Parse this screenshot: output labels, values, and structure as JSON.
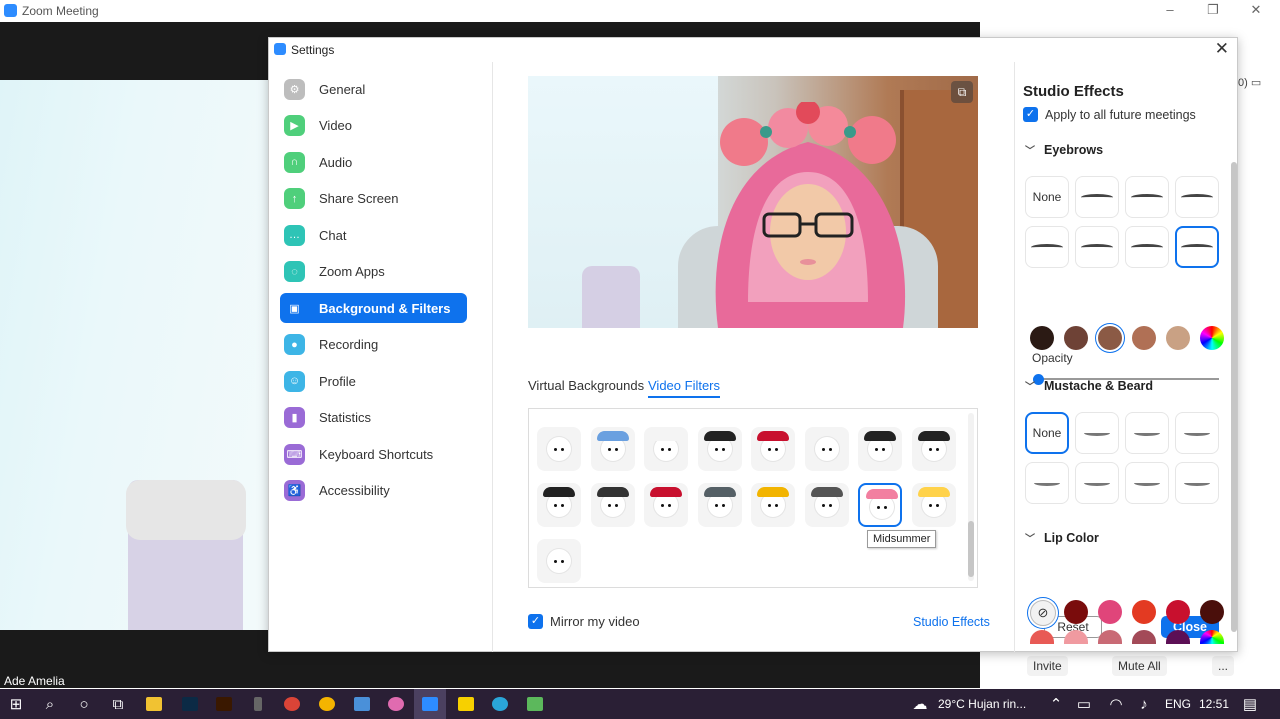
{
  "zoom_window": {
    "title": "Zoom Meeting",
    "participant_name": "Ade Amelia",
    "controls": [
      "Invite",
      "Mute All",
      "..."
    ],
    "side_label": "0)"
  },
  "settings": {
    "title": "Settings",
    "nav": [
      {
        "label": "General",
        "icon": "gear-icon",
        "color": "#bdbdbd"
      },
      {
        "label": "Video",
        "icon": "video-camera-icon",
        "color": "#4fcf7b"
      },
      {
        "label": "Audio",
        "icon": "headphones-icon",
        "color": "#4fcf7b"
      },
      {
        "label": "Share Screen",
        "icon": "share-screen-icon",
        "color": "#4fcf7b"
      },
      {
        "label": "Chat",
        "icon": "chat-icon",
        "color": "#2ec4b6"
      },
      {
        "label": "Zoom Apps",
        "icon": "apps-icon",
        "color": "#2ec4b6"
      },
      {
        "label": "Background & Filters",
        "icon": "background-icon",
        "color": "#ffffff",
        "active": true
      },
      {
        "label": "Recording",
        "icon": "recording-icon",
        "color": "#3db5e6"
      },
      {
        "label": "Profile",
        "icon": "profile-icon",
        "color": "#3db5e6"
      },
      {
        "label": "Statistics",
        "icon": "statistics-icon",
        "color": "#9a6bd6"
      },
      {
        "label": "Keyboard Shortcuts",
        "icon": "keyboard-icon",
        "color": "#9a6bd6"
      },
      {
        "label": "Accessibility",
        "icon": "accessibility-icon",
        "color": "#9a6bd6"
      }
    ],
    "tabs": [
      "Virtual Backgrounds",
      "Video Filters"
    ],
    "active_tab": "Video Filters",
    "tooltip": "Midsummer",
    "mirror_label": "Mirror my video",
    "mirror_checked": true,
    "studio_effects_link": "Studio Effects"
  },
  "studio": {
    "title": "Studio Effects",
    "apply_label": "Apply to all future meetings",
    "apply_checked": true,
    "eyebrows": {
      "label": "Eyebrows",
      "none_label": "None",
      "colors": [
        "#2b1a14",
        "#6e4236",
        "#8b5a45",
        "#b07055",
        "#c9a184",
        "rainbow"
      ],
      "selected_color_index": 2
    },
    "opacity_label": "Opacity",
    "opacity_value": 0.0,
    "mustache": {
      "label": "Mustache & Beard",
      "none_label": "None"
    },
    "lip": {
      "label": "Lip Color",
      "colors_row1": [
        "none",
        "#7a0c0c",
        "#e0457a",
        "#e33a22",
        "#c8102e",
        "#4a0f0b"
      ],
      "colors_row2": [
        "#e85a55",
        "#f09aa0",
        "#c96a75",
        "#a34a58",
        "#5c0f55",
        "rainbow"
      ]
    },
    "reset_label": "Reset",
    "close_label": "Close"
  },
  "taskbar": {
    "weather": "29°C  Hujan rin...",
    "language": "ENG",
    "time": "12:51"
  }
}
